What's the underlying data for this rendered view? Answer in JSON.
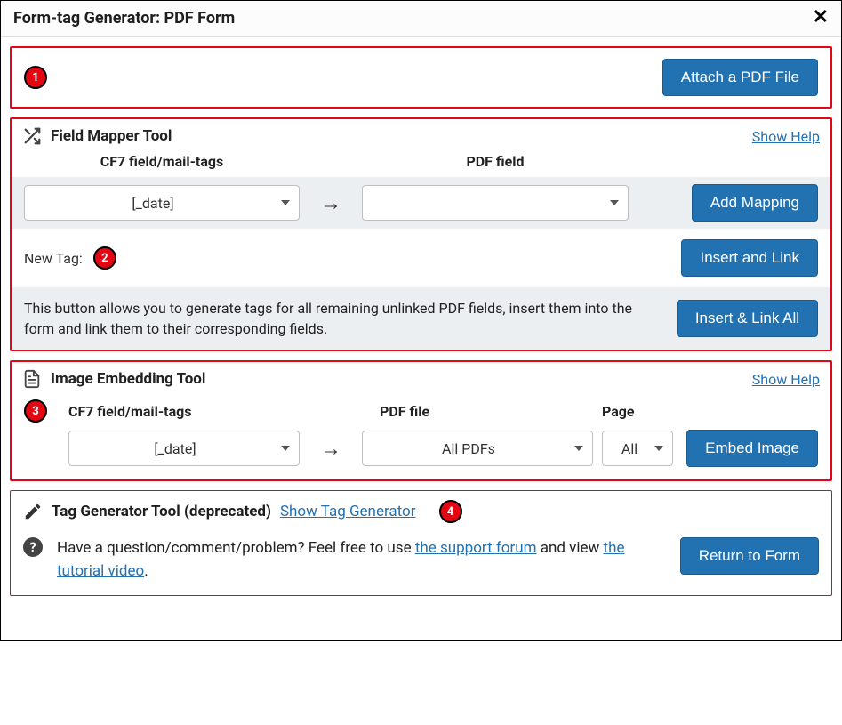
{
  "title": "Form-tag Generator: PDF Form",
  "markers": {
    "m1": "1",
    "m2": "2",
    "m3": "3",
    "m4": "4"
  },
  "attach": {
    "button": "Attach a PDF File"
  },
  "fieldMapper": {
    "title": "Field Mapper Tool",
    "help": "Show Help",
    "cf7Header": "CF7 field/mail-tags",
    "pdfHeader": "PDF field",
    "cf7Value": "[_date]",
    "pdfValue": "",
    "addMapping": "Add Mapping",
    "newTagLabel": "New Tag:",
    "insertLink": "Insert and Link",
    "linkAllDesc": "This button allows you to generate tags for all remaining unlinked PDF fields, insert them into the form and link them to their corresponding fields.",
    "insertLinkAll": "Insert & Link All"
  },
  "imageEmbed": {
    "title": "Image Embedding Tool",
    "help": "Show Help",
    "cf7Header": "CF7 field/mail-tags",
    "pdfHeader": "PDF file",
    "pageHeader": "Page",
    "cf7Value": "[_date]",
    "pdfValue": "All PDFs",
    "pageValue": "All",
    "embed": "Embed Image"
  },
  "tagGen": {
    "title": "Tag Generator Tool (deprecated)",
    "showLink": "Show Tag Generator",
    "questionPrefix": "Have a question/comment/problem? Feel free to use ",
    "supportLink": "the support forum",
    "questionMid": " and view ",
    "tutorialLink": "the tutorial video",
    "questionEnd": ".",
    "returnBtn": "Return to Form"
  }
}
